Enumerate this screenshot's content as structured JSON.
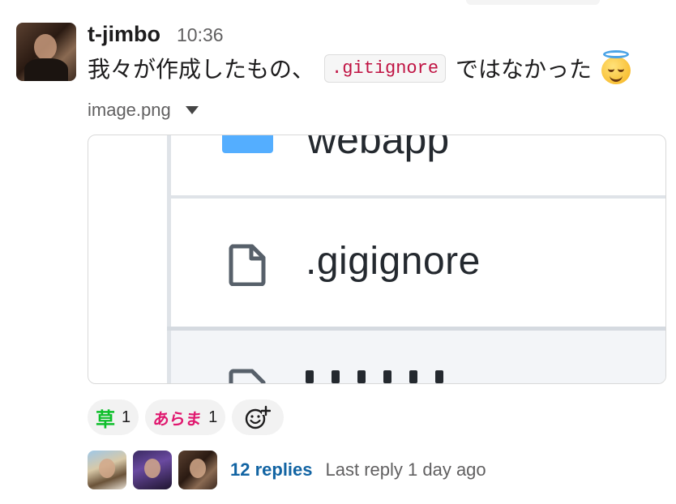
{
  "message": {
    "author": "t-jimbo",
    "time": "10:36",
    "text_before": "我々が作成したもの、",
    "code": ".gitignore",
    "text_after": "ではなかった",
    "emoji": "innocent-smile-halo"
  },
  "attachment": {
    "filename": "image.png",
    "preview": {
      "folder_name": "webapp",
      "file_name": ".gigignore"
    }
  },
  "reactions": [
    {
      "emoji_text": "草",
      "count": "1",
      "emoji_color": "#0fbf2c"
    },
    {
      "emoji_text": "あらま",
      "count": "1",
      "emoji_color": "#e0186f"
    }
  ],
  "thread": {
    "reply_count_label": "12 replies",
    "last_reply_label": "Last reply 1 day ago"
  },
  "colors": {
    "link": "#1264a3",
    "code_text": "#c01343",
    "muted_text": "#616061",
    "folder_blue": "#54aeff"
  }
}
